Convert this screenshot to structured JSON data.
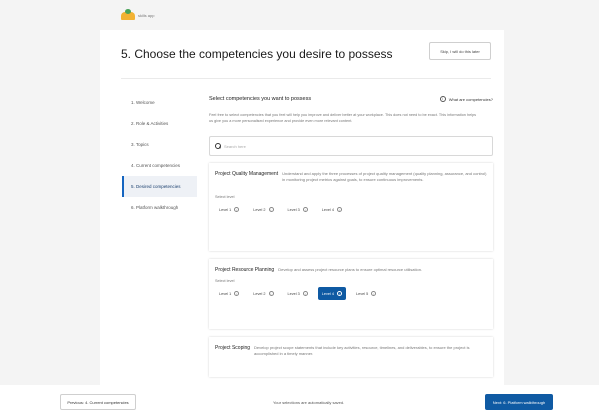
{
  "app": {
    "logo_text": "skills app"
  },
  "header": {
    "title": "5. Choose the competencies you desire to possess",
    "skip_label": "Skip, I will do this later"
  },
  "steps": [
    {
      "label": "1. Welcome",
      "active": false
    },
    {
      "label": "2. Role & Activities",
      "active": false
    },
    {
      "label": "3. Topics",
      "active": false
    },
    {
      "label": "4. Current competencies",
      "active": false
    },
    {
      "label": "5. Desired competencies",
      "active": true
    },
    {
      "label": "6. Platform walkthrough",
      "active": false
    }
  ],
  "main": {
    "section_title": "Select competencies you want to possess",
    "what_link": "What are competencies?",
    "intro": "Feel free to select competencies that you feel will help you improve and deliver better at your workplace. This does not need to be exact. This information helps us give you a more personalised experience and provide even more relevant content.",
    "search_placeholder": "Search here"
  },
  "competencies": [
    {
      "title": "Project Quality Management",
      "description": "Understand and apply the three processes of project quality management (quality planning, assurance, and control) in monitoring project metrics against goals, to ensure continuous improvements.",
      "select_level_label": "Select level",
      "levels": [
        "Level 1",
        "Level 2",
        "Level 3",
        "Level 4"
      ],
      "selected_level": null
    },
    {
      "title": "Project Resource Planning",
      "description": "Develop and assess project resource plans to ensure optimal resource utilisation.",
      "select_level_label": "Select level",
      "levels": [
        "Level 1",
        "Level 2",
        "Level 3",
        "Level 4",
        "Level 5"
      ],
      "selected_level": "Level 4"
    },
    {
      "title": "Project Scoping",
      "description": "Develop project scope statements that include key activities, resource, timelines, and deliverables, to ensure the project is accomplished in a timely manner."
    }
  ],
  "footer": {
    "prev_label": "Previous: 4. Current competencies",
    "save_note": "Your selections are automatically saved.",
    "next_label": "Next: 6. Platform walkthrough"
  },
  "colors": {
    "primary": "#0f5aa3",
    "background": "#f4f4f4",
    "active_step_bg": "#eef1f6"
  }
}
